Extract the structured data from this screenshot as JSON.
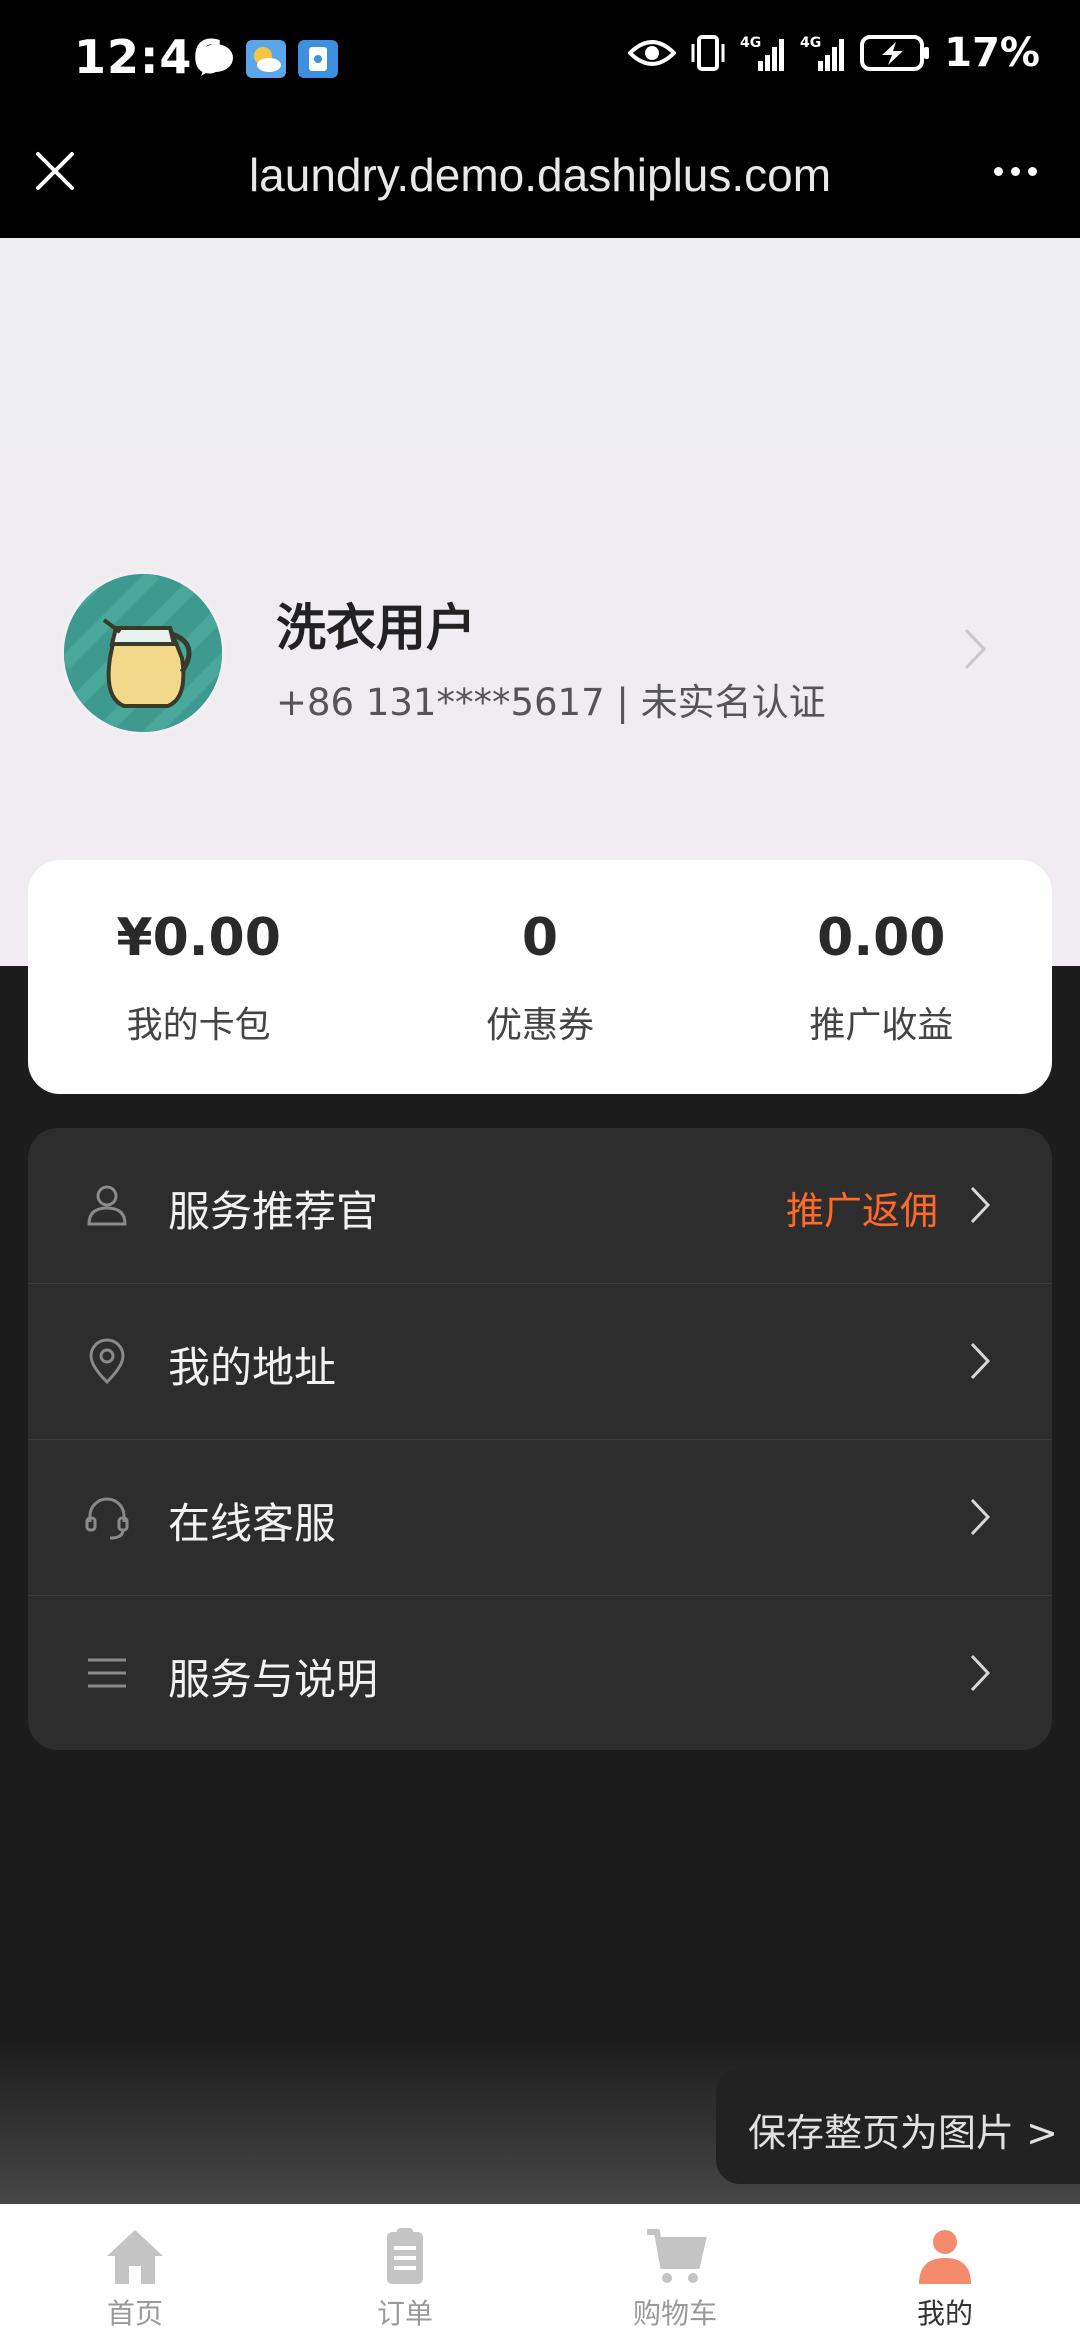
{
  "status_bar": {
    "time": "12:46",
    "battery": "17%",
    "icons": [
      "chat-icon",
      "weather-icon",
      "app-notification-icon",
      "eye-icon",
      "vibrate-icon",
      "signal-4g-icon",
      "signal-4g-icon",
      "battery-charging-icon"
    ]
  },
  "browser": {
    "url": "laundry.demo.dashiplus.com"
  },
  "profile": {
    "name": "洗衣用户",
    "subtitle": "+86 131****5617 | 未实名认证"
  },
  "stats": [
    {
      "value": "¥0.00",
      "label": "我的卡包"
    },
    {
      "value": "0",
      "label": "优惠券"
    },
    {
      "value": "0.00",
      "label": "推广收益"
    }
  ],
  "menu": [
    {
      "label": "服务推荐官",
      "extra": "推广返佣",
      "icon": "person-icon"
    },
    {
      "label": "我的地址",
      "extra": "",
      "icon": "location-pin-icon"
    },
    {
      "label": "在线客服",
      "extra": "",
      "icon": "headset-icon"
    },
    {
      "label": "服务与说明",
      "extra": "",
      "icon": "list-icon"
    }
  ],
  "save_button": "保存整页为图片 >",
  "tabs": [
    {
      "label": "首页",
      "icon": "home-icon"
    },
    {
      "label": "订单",
      "icon": "order-clipboard-icon"
    },
    {
      "label": "购物车",
      "icon": "cart-icon"
    },
    {
      "label": "我的",
      "icon": "user-icon",
      "active": true
    }
  ],
  "colors": {
    "accent": "#ff6a2a",
    "tab_active": "#f58a6c",
    "tab_inactive": "#c4c4c4",
    "menu_bg": "#2d2d2d",
    "page_bg": "#1c1c1c"
  }
}
